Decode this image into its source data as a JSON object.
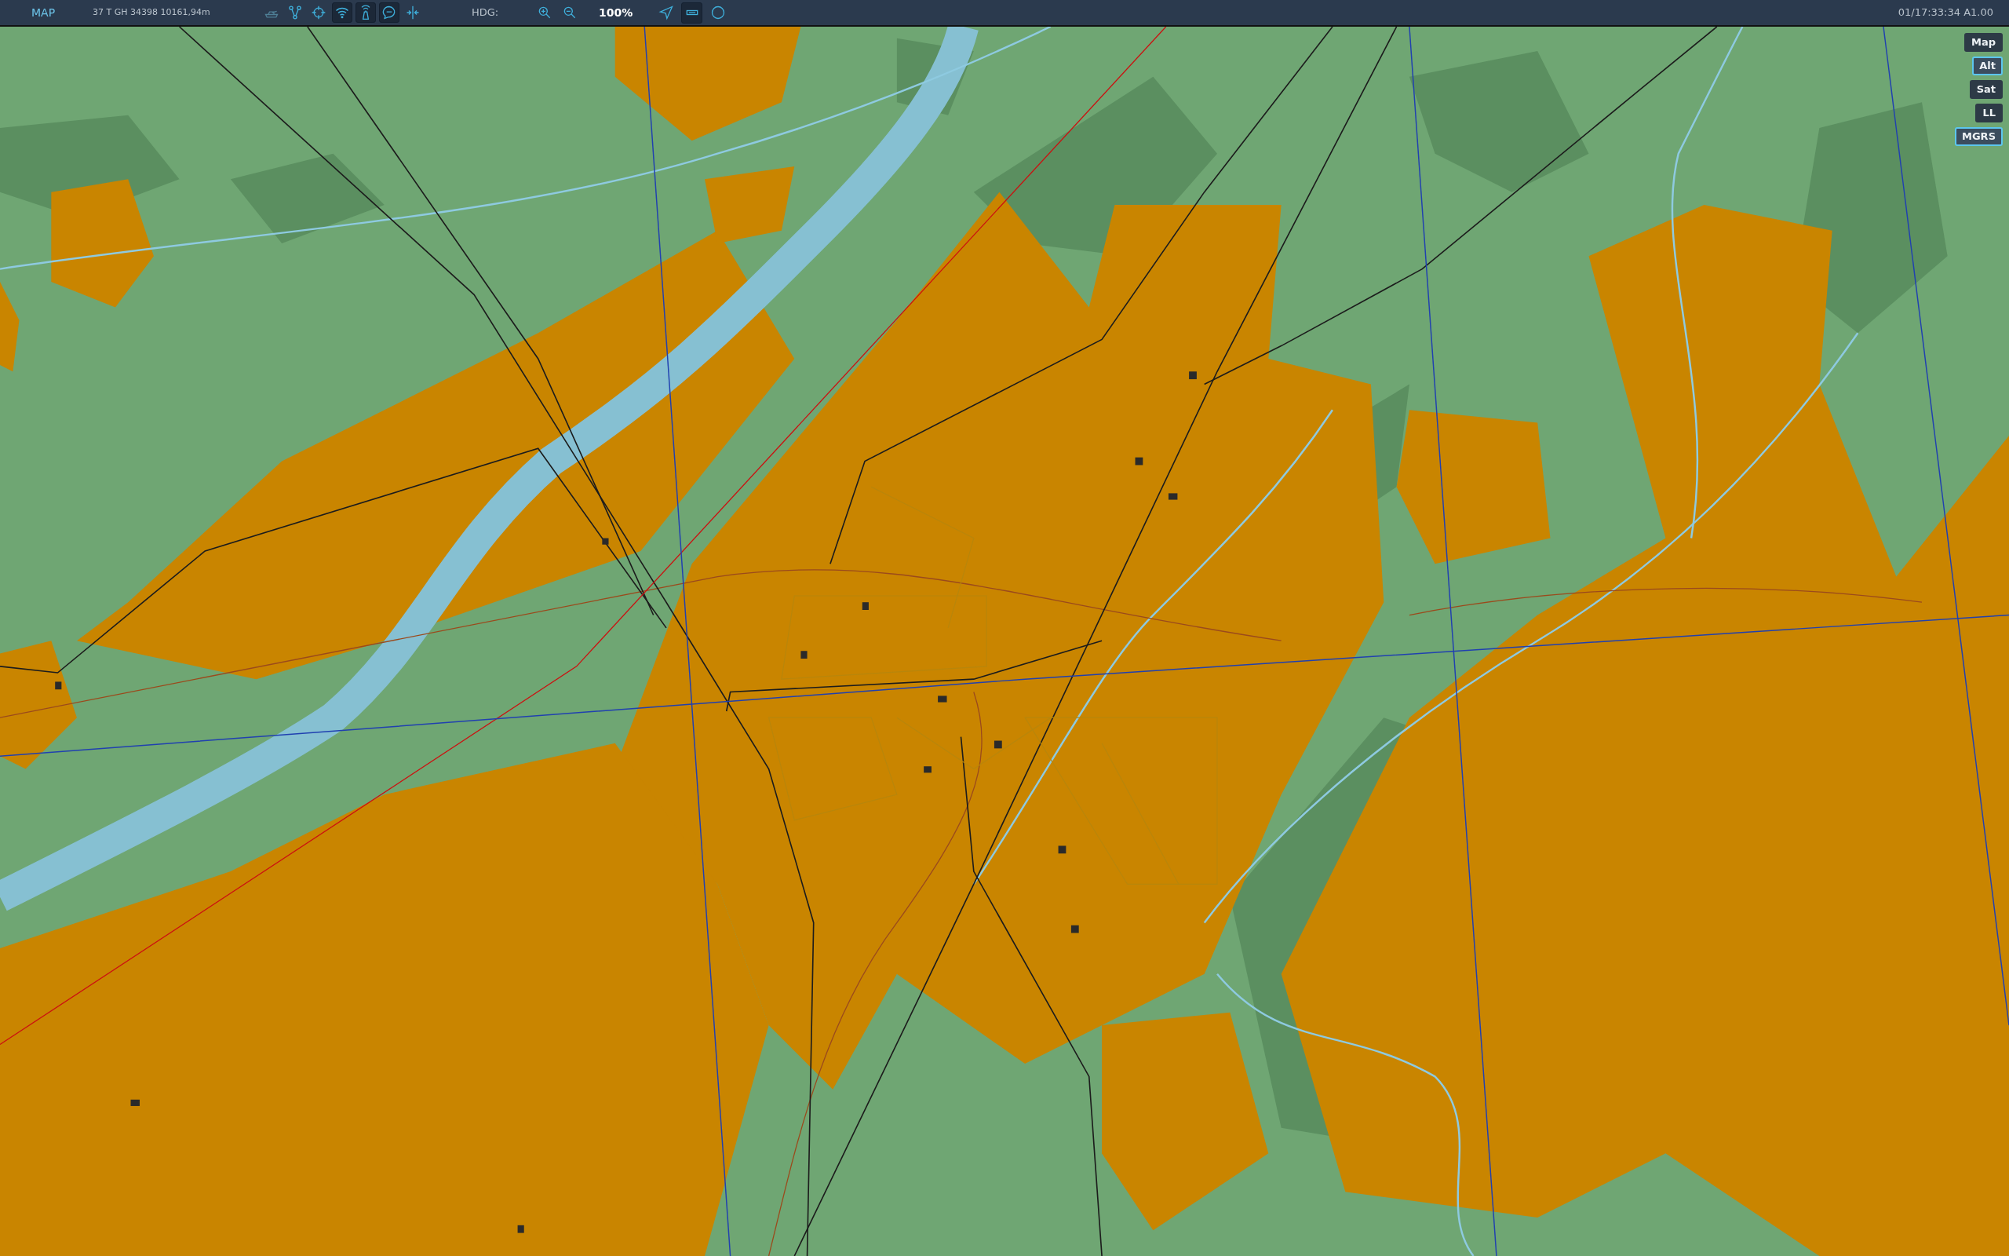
{
  "toolbar": {
    "title": "MAP",
    "coordinates": "37 T GH 34398 10161,94m",
    "tools": [
      {
        "kind": "tank",
        "on": false,
        "disabled": true
      },
      {
        "kind": "network",
        "on": false,
        "disabled": false
      },
      {
        "kind": "crosshair",
        "on": false,
        "disabled": false
      },
      {
        "kind": "wifi",
        "on": true,
        "disabled": false
      },
      {
        "kind": "tower",
        "on": true,
        "disabled": false
      },
      {
        "kind": "chat",
        "on": true,
        "disabled": false
      },
      {
        "kind": "split",
        "on": false,
        "disabled": false
      }
    ],
    "heading_label": "HDG:",
    "zoom": "100%",
    "view_tools": [
      {
        "kind": "pointer",
        "on": false
      },
      {
        "kind": "rectangle",
        "on": true
      },
      {
        "kind": "circle",
        "on": false
      }
    ],
    "time": "01/17:33:34 A1.00"
  },
  "layers": [
    {
      "label": "Map",
      "selected": false
    },
    {
      "label": "Alt",
      "selected": true
    },
    {
      "label": "Sat",
      "selected": false
    },
    {
      "label": "LL",
      "selected": false
    },
    {
      "label": "MGRS",
      "selected": true
    }
  ]
}
